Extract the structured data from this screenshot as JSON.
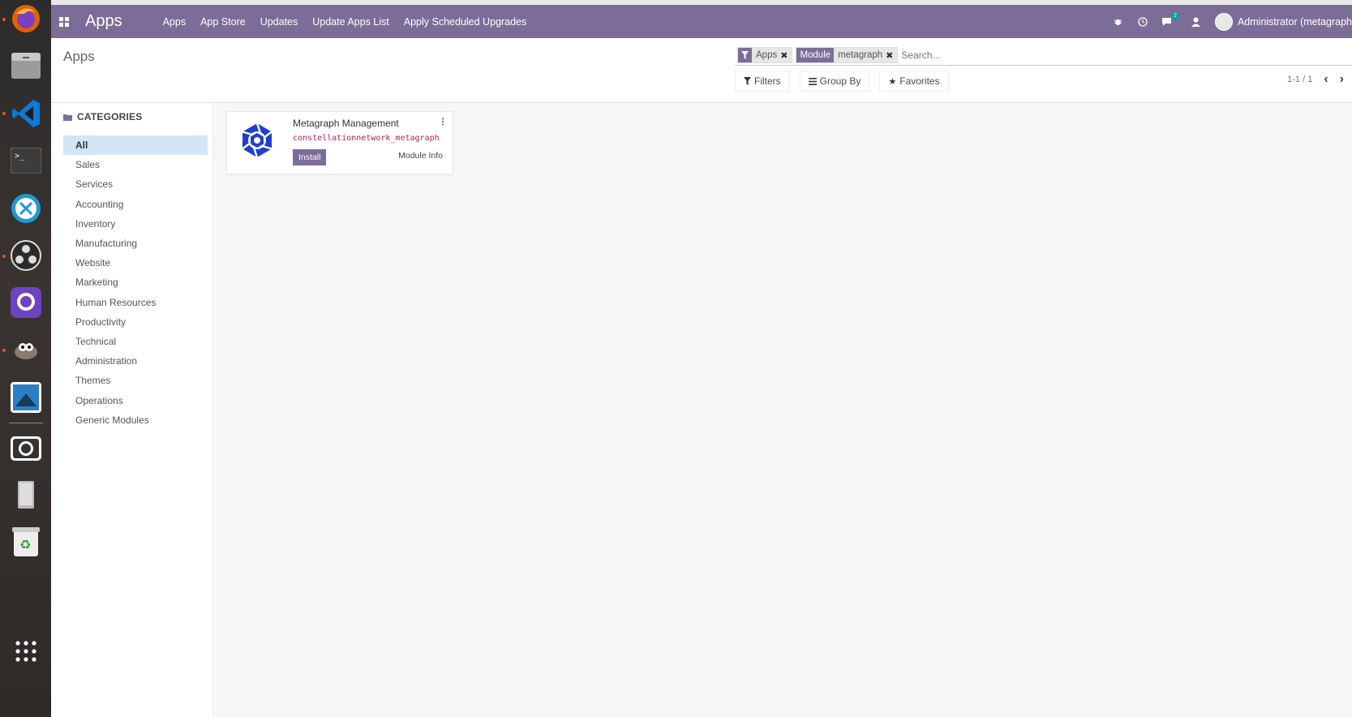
{
  "navbar": {
    "brand": "Apps",
    "menu": [
      "Apps",
      "App Store",
      "Updates",
      "Update Apps List",
      "Apply Scheduled Upgrades"
    ],
    "chat_badge": "2",
    "user": "Administrator (metagraph"
  },
  "control": {
    "breadcrumb": "Apps",
    "facets": [
      {
        "label_icon": "filter-icon",
        "value": "Apps"
      },
      {
        "label": "Module",
        "value": "metagraph"
      }
    ],
    "search_placeholder": "Search...",
    "filters_label": "Filters",
    "groupby_label": "Group By",
    "favorites_label": "Favorites",
    "pager": "1-1 / 1"
  },
  "sidebar": {
    "heading": "CATEGORIES",
    "items": [
      "All",
      "Sales",
      "Services",
      "Accounting",
      "Inventory",
      "Manufacturing",
      "Website",
      "Marketing",
      "Human Resources",
      "Productivity",
      "Technical",
      "Administration",
      "Themes",
      "Operations",
      "Generic Modules"
    ],
    "active_index": 0
  },
  "card": {
    "title": "Metagraph Management",
    "technical_name": "constellationnetwork_metagraph",
    "install_label": "Install",
    "info_label": "Module Info"
  },
  "colors": {
    "brand": "#7c6d98",
    "active_category": "#d3e6f6",
    "technical_name": "#c2185b"
  }
}
